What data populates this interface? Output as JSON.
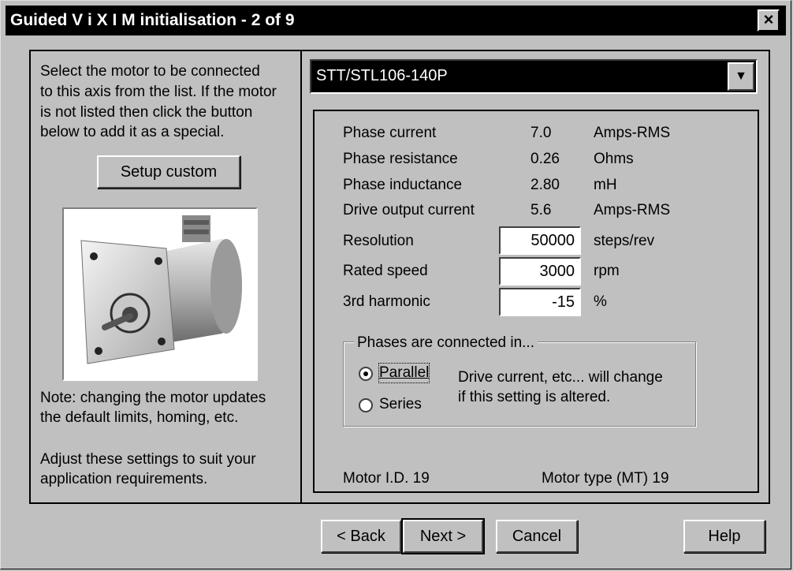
{
  "window": {
    "title": "Guided V i X I M initialisation - 2 of 9",
    "close_glyph": "×"
  },
  "left_panel": {
    "instructions": [
      "Select the motor to be connected",
      "to this axis from the list. If the motor",
      "is not listed then click the button",
      "below to add it as a special."
    ],
    "setup_custom_label": "Setup custom",
    "note": [
      "Note: changing the motor updates",
      "the default limits, homing, etc."
    ],
    "adjust": [
      "Adjust these settings to suit your",
      "application requirements."
    ]
  },
  "motor_select": {
    "value": "STT/STL106-140P",
    "arrow_glyph": "▼"
  },
  "specs": [
    {
      "label": "Phase current",
      "value": "7.0",
      "unit": "Amps-RMS"
    },
    {
      "label": "Phase resistance",
      "value": "0.26",
      "unit": "Ohms"
    },
    {
      "label": "Phase inductance",
      "value": "2.80",
      "unit": "mH"
    },
    {
      "label": "Drive output current",
      "value": "5.6",
      "unit": "Amps-RMS"
    }
  ],
  "settings": [
    {
      "label": "Resolution",
      "value": "50000",
      "unit": "steps/rev"
    },
    {
      "label": "Rated speed",
      "value": "3000",
      "unit": "rpm"
    },
    {
      "label": "3rd harmonic",
      "value": "-15",
      "unit": "%"
    }
  ],
  "phases": {
    "title": "Phases are connected in...",
    "parallel_label": "Parallel",
    "series_label": "Series",
    "selected": "Parallel",
    "hint": [
      "Drive current, etc... will change",
      "if this setting is altered."
    ]
  },
  "footer_info": {
    "motor_id": "Motor I.D. 19",
    "motor_type": "Motor type (MT) 19"
  },
  "buttons": {
    "back": "< Back",
    "next": "Next >",
    "cancel": "Cancel",
    "help": "Help"
  }
}
